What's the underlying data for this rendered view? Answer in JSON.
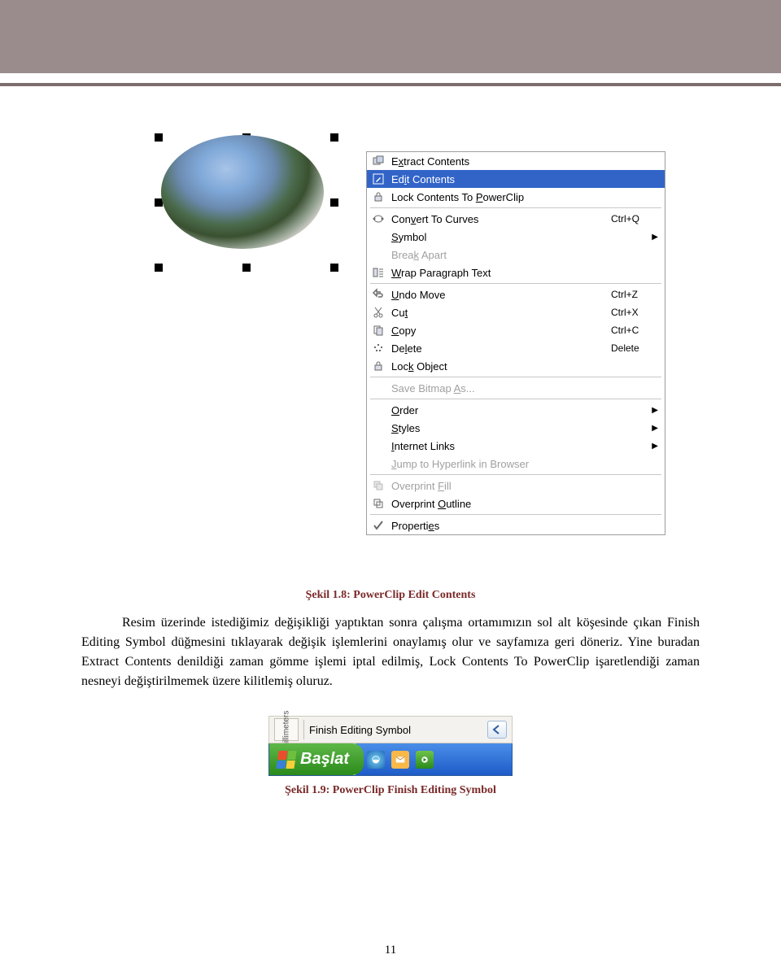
{
  "figure1_caption": "Şekil 1.8: PowerClip Edit Contents",
  "body_paragraph": "Resim üzerinde istediğimiz değişikliği yaptıktan sonra çalışma ortamımızın sol alt köşesinde çıkan Finish Editing Symbol düğmesini tıklayarak değişik işlemlerini onaylamış olur ve sayfamıza geri döneriz. Yine buradan Extract Contents denildiği zaman gömme işlemi iptal edilmiş, Lock Contents To PowerClip işaretlendiği zaman nesneyi değiştirilmemek üzere kilitlemiş oluruz.",
  "figure2_caption": "Şekil 1.9: PowerClip Finish Editing Symbol",
  "page_number": "11",
  "context_menu": {
    "items": [
      {
        "icon": "extract-icon",
        "label_pre": "E",
        "ul": "x",
        "label_post": "tract Contents"
      },
      {
        "icon": "edit-icon",
        "label_pre": "Ed",
        "ul": "i",
        "label_post": "t Contents",
        "highlight": true
      },
      {
        "icon": "lock-icon",
        "label_pre": "Lock Contents To ",
        "ul": "P",
        "label_post": "owerClip"
      },
      {
        "sep": true
      },
      {
        "icon": "curves-icon",
        "label_pre": "Con",
        "ul": "v",
        "label_post": "ert To Curves",
        "shortcut": "Ctrl+Q"
      },
      {
        "icon": "",
        "label_pre": "",
        "ul": "S",
        "label_post": "ymbol",
        "arrow": true
      },
      {
        "icon": "",
        "label_pre": "Brea",
        "ul": "k",
        "label_post": " Apart",
        "disabled": true
      },
      {
        "icon": "wrap-icon",
        "label_pre": "",
        "ul": "W",
        "label_post": "rap Paragraph Text"
      },
      {
        "sep": true
      },
      {
        "icon": "undo-icon",
        "label_pre": "",
        "ul": "U",
        "label_post": "ndo Move",
        "shortcut": "Ctrl+Z"
      },
      {
        "icon": "cut-icon",
        "label_pre": "Cu",
        "ul": "t",
        "label_post": "",
        "shortcut": "Ctrl+X"
      },
      {
        "icon": "copy-icon",
        "label_pre": "",
        "ul": "C",
        "label_post": "opy",
        "shortcut": "Ctrl+C"
      },
      {
        "icon": "delete-icon",
        "label_pre": "De",
        "ul": "l",
        "label_post": "ete",
        "shortcut": "Delete"
      },
      {
        "icon": "lockobj-icon",
        "label_pre": "Loc",
        "ul": "k",
        "label_post": " Object"
      },
      {
        "sep": true
      },
      {
        "icon": "",
        "label_pre": "Save Bitmap ",
        "ul": "A",
        "label_post": "s...",
        "disabled": true
      },
      {
        "sep": true
      },
      {
        "icon": "",
        "label_pre": "",
        "ul": "O",
        "label_post": "rder",
        "arrow": true
      },
      {
        "icon": "",
        "label_pre": "",
        "ul": "S",
        "label_post": "tyles",
        "arrow": true
      },
      {
        "icon": "",
        "label_pre": "",
        "ul": "I",
        "label_post": "nternet Links",
        "arrow": true
      },
      {
        "icon": "",
        "label_pre": "",
        "ul": "J",
        "label_post": "ump to Hyperlink in Browser",
        "disabled": true
      },
      {
        "sep": true
      },
      {
        "icon": "opfill-icon",
        "label_pre": "Overprint ",
        "ul": "F",
        "label_post": "ill",
        "disabled": true
      },
      {
        "icon": "opoutline-icon",
        "label_pre": "Overprint ",
        "ul": "O",
        "label_post": "utline"
      },
      {
        "sep": true
      },
      {
        "icon": "check-icon",
        "label_pre": "Properti",
        "ul": "e",
        "label_post": "s"
      }
    ]
  },
  "toolbar": {
    "mm_label": "millimeters",
    "fes_label": "Finish Editing Symbol",
    "start_label": "Başlat"
  }
}
